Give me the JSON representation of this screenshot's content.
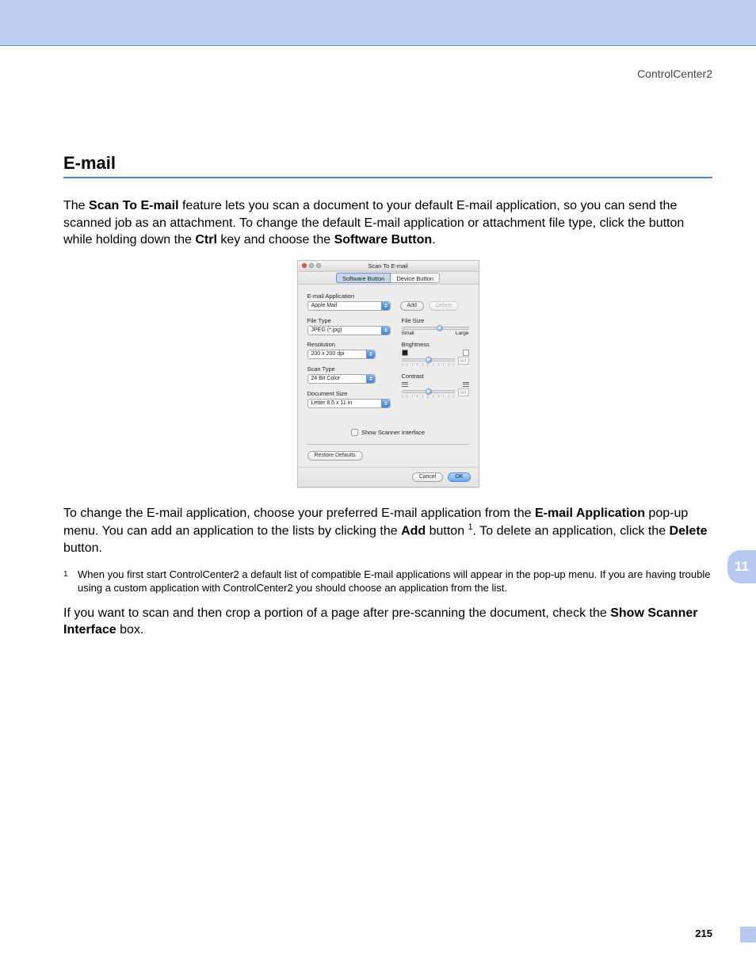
{
  "header": {
    "app_name": "ControlCenter2"
  },
  "section": {
    "title": "E-mail"
  },
  "paragraphs": {
    "p1_a": "The ",
    "p1_b": "Scan To E-mail",
    "p1_c": " feature lets you scan a document to your default E-mail application, so you can send the scanned job as an attachment. To change the default E-mail application or attachment file type, click the button while holding down the ",
    "p1_d": "Ctrl",
    "p1_e": " key and choose the ",
    "p1_f": "Software Button",
    "p1_g": ".",
    "p2_a": "To change the E-mail application, choose your preferred E-mail application from the ",
    "p2_b": "E-mail Application",
    "p2_c": " pop-up menu. You can add an application to the lists by clicking the ",
    "p2_d": "Add",
    "p2_e": " button ",
    "p2_sup": "1",
    "p2_f": ". To delete an application, click the ",
    "p2_g": "Delete",
    "p2_h": " button.",
    "p3_a": "If you want to scan and then crop a portion of a page after pre-scanning the document, check the ",
    "p3_b": "Show Scanner Interface",
    "p3_c": " box."
  },
  "footnote": {
    "num": "1",
    "text": "When you first start ControlCenter2 a default list of compatible E-mail applications will appear in the pop-up menu. If you are having trouble using a custom application with ControlCenter2 you should choose an application from the list."
  },
  "dialog": {
    "title": "Scan To E-mail",
    "tabs": {
      "software": "Software Button",
      "device": "Device Button"
    },
    "labels": {
      "email_app": "E-mail Application",
      "file_type": "File Type",
      "file_size": "File Size",
      "resolution": "Resolution",
      "brightness": "Brightness",
      "scan_type": "Scan Type",
      "contrast": "Contrast",
      "document_size": "Document Size",
      "small": "Small",
      "large": "Large",
      "show_scanner_interface": "Show Scanner Interface"
    },
    "values": {
      "email_app": "Apple Mail",
      "file_type": "JPEG (*.jpg)",
      "resolution": "200 x 200 dpi",
      "scan_type": "24 Bit Color",
      "document_size": "Letter  8.5 x 11 in",
      "brightness_value": "50",
      "contrast_value": "50"
    },
    "buttons": {
      "add": "Add",
      "delete": "Delete",
      "restore": "Restore Defaults",
      "cancel": "Cancel",
      "ok": "OK"
    }
  },
  "chapter_tab": "11",
  "page_number": "215"
}
